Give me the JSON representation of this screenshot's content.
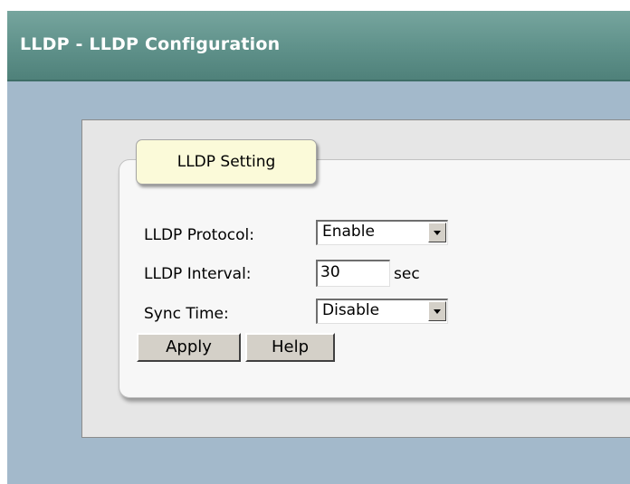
{
  "header": {
    "title": "LLDP - LLDP Configuration"
  },
  "settings": {
    "legend": "LLDP Setting",
    "protocol": {
      "label": "LLDP Protocol:",
      "value": "Enable",
      "icon": "chevron-down-icon"
    },
    "interval": {
      "label": "LLDP Interval:",
      "value": "30",
      "unit": "sec"
    },
    "sync_time": {
      "label": "Sync Time:",
      "value": "Disable",
      "icon": "chevron-down-icon"
    }
  },
  "buttons": {
    "apply": "Apply",
    "help": "Help"
  },
  "colors": {
    "header_bg": "#5f918a",
    "page_bg": "#a3b9cb",
    "legend_bg": "#fbfad9",
    "button_face": "#d4d0c8"
  }
}
